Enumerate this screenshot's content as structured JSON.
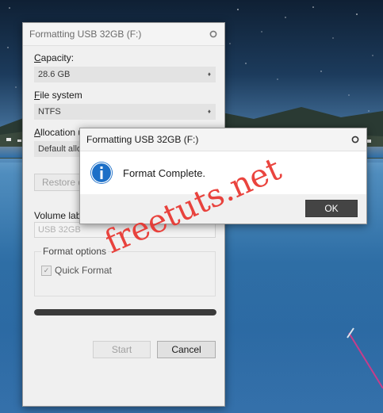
{
  "format_window": {
    "title": "Formatting USB 32GB (F:)",
    "capacity": {
      "label_accel": "C",
      "label_rest": "apacity:",
      "value": "28.6 GB"
    },
    "file_system": {
      "label_accel": "F",
      "label_rest": "ile system",
      "value": "NTFS"
    },
    "allocation": {
      "label_accel": "A",
      "label_rest": "llocation ur",
      "value": "Default allo"
    },
    "restore_button": "Restore d",
    "volume": {
      "label": "Volume label",
      "value": "USB 32GB"
    },
    "format_options": {
      "label": "Format options",
      "quick_format": "Quick Format",
      "quick_format_checked": true
    },
    "progress": 1.0,
    "start_button": "Start",
    "cancel_button": "Cancel"
  },
  "message_box": {
    "title": "Formatting USB 32GB (F:)",
    "icon": "info-icon",
    "message": "Format Complete.",
    "ok_button": "OK"
  },
  "watermark": {
    "text": "freetuts.net",
    "color": "#e8302a"
  },
  "colors": {
    "dark_button": "#444444",
    "info_blue": "#1c6fc7",
    "progress": "#3a3a3a"
  }
}
